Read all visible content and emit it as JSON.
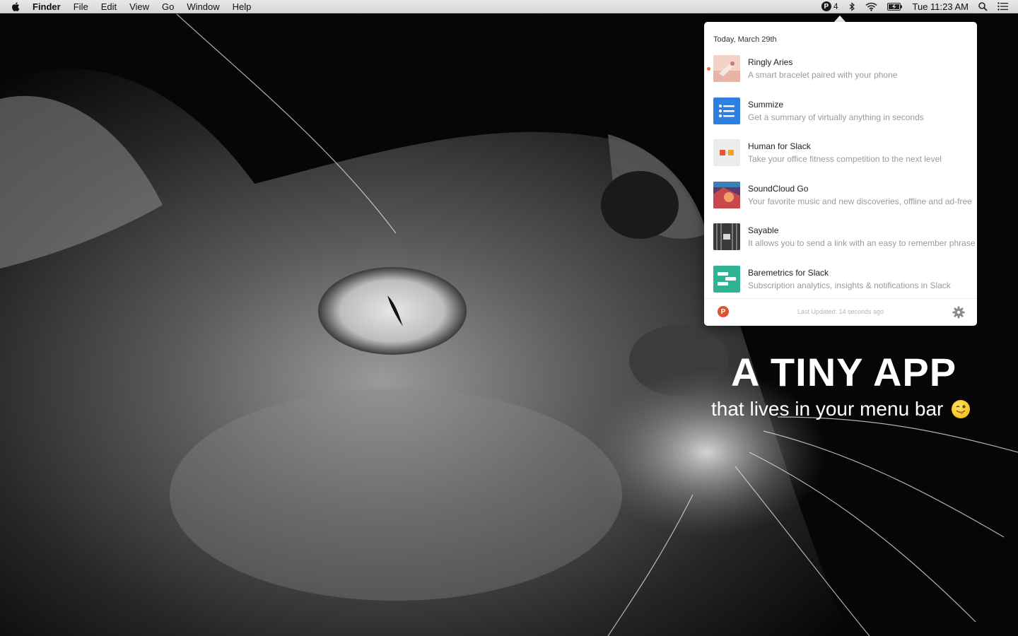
{
  "menubar": {
    "app_name": "Finder",
    "menus": [
      "File",
      "Edit",
      "View",
      "Go",
      "Window",
      "Help"
    ],
    "status": {
      "producthunt_badge": "P",
      "producthunt_count": "4",
      "clock": "Tue 11:23 AM"
    }
  },
  "popover": {
    "date_header": "Today, March 29th",
    "posts": [
      {
        "name": "Ringly Aries",
        "tagline": "A smart bracelet paired with your phone",
        "unread": true,
        "thumb_color": "#f3d3c8"
      },
      {
        "name": "Summize",
        "tagline": "Get a summary of virtually anything in seconds",
        "unread": false,
        "thumb_color": "#2f7fe0"
      },
      {
        "name": "Human for Slack",
        "tagline": "Take your office fitness competition to the next level",
        "unread": false,
        "thumb_color": "#ececec"
      },
      {
        "name": "SoundCloud Go",
        "tagline": "Your favorite music and new discoveries, offline and ad-free",
        "unread": false,
        "thumb_color": "#b8474b"
      },
      {
        "name": "Sayable",
        "tagline": "It allows you to send a link with an easy to remember phrase",
        "unread": false,
        "thumb_color": "#3a3a3a"
      },
      {
        "name": "Baremetrics for Slack",
        "tagline": "Subscription analytics, insights & notifications in Slack",
        "unread": false,
        "thumb_color": "#2fb394"
      }
    ],
    "footer": {
      "logo_letter": "P",
      "last_updated": "Last Updated: 14 seconds ago"
    }
  },
  "hero": {
    "title": "A TINY APP",
    "subtitle": "that lives in your menu bar"
  },
  "colors": {
    "producthunt_orange": "#da552f",
    "unread_dot": "#e9743b"
  }
}
